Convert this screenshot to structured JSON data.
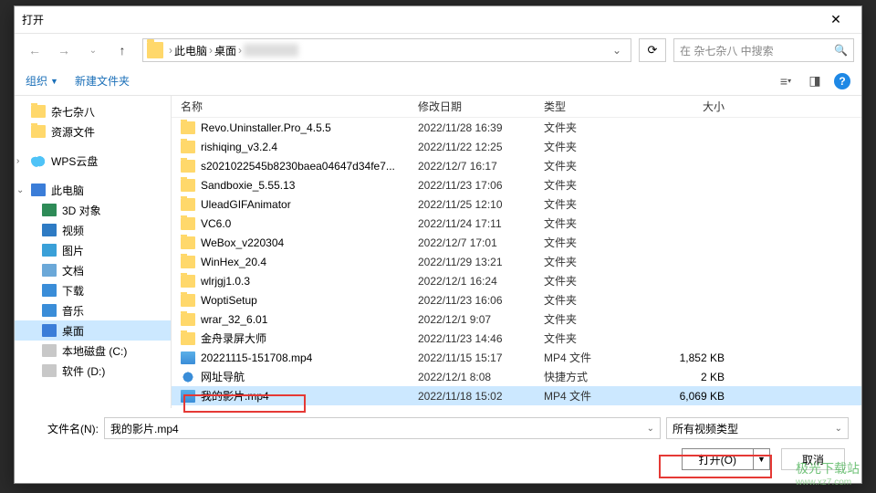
{
  "window": {
    "title": "打开"
  },
  "breadcrumb": {
    "root": "此电脑",
    "loc": "桌面"
  },
  "search": {
    "placeholder": "在 杂七杂八 中搜索"
  },
  "toolbar": {
    "organize": "组织",
    "newfolder": "新建文件夹"
  },
  "sidebar": {
    "items": [
      {
        "label": "杂七杂八",
        "icon": "i-folder",
        "indent": "top"
      },
      {
        "label": "资源文件",
        "icon": "i-folder",
        "indent": "top"
      },
      {
        "label": "WPS云盘",
        "icon": "i-cloud",
        "indent": "top",
        "expand": "›"
      },
      {
        "label": "此电脑",
        "icon": "i-pc",
        "indent": "top",
        "expand": "⌄"
      },
      {
        "label": "3D 对象",
        "icon": "i-3d"
      },
      {
        "label": "视频",
        "icon": "i-video"
      },
      {
        "label": "图片",
        "icon": "i-image"
      },
      {
        "label": "文档",
        "icon": "i-doc"
      },
      {
        "label": "下载",
        "icon": "i-download"
      },
      {
        "label": "音乐",
        "icon": "i-music"
      },
      {
        "label": "桌面",
        "icon": "i-desktop",
        "selected": true
      },
      {
        "label": "本地磁盘 (C:)",
        "icon": "i-disk"
      },
      {
        "label": "软件 (D:)",
        "icon": "i-disk"
      }
    ]
  },
  "columns": {
    "name": "名称",
    "date": "修改日期",
    "type": "类型",
    "size": "大小"
  },
  "files": [
    {
      "name": "Revo.Uninstaller.Pro_4.5.5",
      "date": "2022/11/28 16:39",
      "type": "文件夹",
      "size": "",
      "icon": "i-folder"
    },
    {
      "name": "rishiqing_v3.2.4",
      "date": "2022/11/22 12:25",
      "type": "文件夹",
      "size": "",
      "icon": "i-folder"
    },
    {
      "name": "s2021022545b8230baea04647d34fe7...",
      "date": "2022/12/7 16:17",
      "type": "文件夹",
      "size": "",
      "icon": "i-folder"
    },
    {
      "name": "Sandboxie_5.55.13",
      "date": "2022/11/23 17:06",
      "type": "文件夹",
      "size": "",
      "icon": "i-folder"
    },
    {
      "name": "UleadGIFAnimator",
      "date": "2022/11/25 12:10",
      "type": "文件夹",
      "size": "",
      "icon": "i-folder"
    },
    {
      "name": "VC6.0",
      "date": "2022/11/24 17:11",
      "type": "文件夹",
      "size": "",
      "icon": "i-folder"
    },
    {
      "name": "WeBox_v220304",
      "date": "2022/12/7 17:01",
      "type": "文件夹",
      "size": "",
      "icon": "i-folder"
    },
    {
      "name": "WinHex_20.4",
      "date": "2022/11/29 13:21",
      "type": "文件夹",
      "size": "",
      "icon": "i-folder"
    },
    {
      "name": "wlrjgj1.0.3",
      "date": "2022/12/1 16:24",
      "type": "文件夹",
      "size": "",
      "icon": "i-folder"
    },
    {
      "name": "WoptiSetup",
      "date": "2022/11/23 16:06",
      "type": "文件夹",
      "size": "",
      "icon": "i-folder"
    },
    {
      "name": "wrar_32_6.01",
      "date": "2022/12/1 9:07",
      "type": "文件夹",
      "size": "",
      "icon": "i-folder"
    },
    {
      "name": "金舟录屏大师",
      "date": "2022/11/23 14:46",
      "type": "文件夹",
      "size": "",
      "icon": "i-folder"
    },
    {
      "name": "20221115-151708.mp4",
      "date": "2022/11/15 15:17",
      "type": "MP4 文件",
      "size": "1,852 KB",
      "icon": "i-mp4"
    },
    {
      "name": "网址导航",
      "date": "2022/12/1 8:08",
      "type": "快捷方式",
      "size": "2 KB",
      "icon": "i-ie"
    },
    {
      "name": "我的影片.mp4",
      "date": "2022/11/18 15:02",
      "type": "MP4 文件",
      "size": "6,069 KB",
      "icon": "i-mp4",
      "selected": true
    }
  ],
  "footer": {
    "filename_label": "文件名(N):",
    "filename_value": "我的影片.mp4",
    "filetype": "所有视频类型",
    "open": "打开(O)",
    "cancel": "取消"
  },
  "watermark": {
    "brand": "极光下载站",
    "url": "www.xz7.com"
  }
}
